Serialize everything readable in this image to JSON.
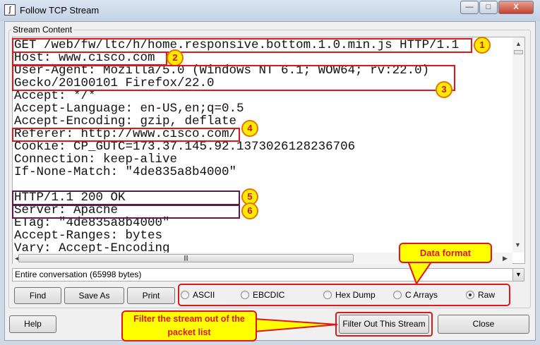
{
  "window": {
    "title": "Follow TCP Stream",
    "minimize": "—",
    "maximize": "□",
    "close": "X"
  },
  "group_label": "Stream Content",
  "stream_lines": [
    "GET /web/fw/ltc/h/home.responsive.bottom.1.0.min.js HTTP/1.1",
    "Host: www.cisco.com",
    "User-Agent: Mozilla/5.0 (Windows NT 6.1; WOW64; rv:22.0)",
    "Gecko/20100101 Firefox/22.0",
    "Accept: */*",
    "Accept-Language: en-US,en;q=0.5",
    "Accept-Encoding: gzip, deflate",
    "Referer: http://www.cisco.com/",
    "Cookie: CP_GUTC=173.37.145.92.1373026128236706",
    "Connection: keep-alive",
    "If-None-Match: \"4de835a8b4000\"",
    "",
    "HTTP/1.1 200 OK",
    "Server: Apache",
    "ETag: \"4de835a8b4000\"",
    "Accept-Ranges: bytes",
    "Vary: Accept-Encoding"
  ],
  "annotations": [
    "1",
    "2",
    "3",
    "4",
    "5",
    "6"
  ],
  "conversation_select": "Entire conversation (65998 bytes)",
  "buttons": {
    "find": "Find",
    "save_as": "Save As",
    "print": "Print",
    "help": "Help",
    "filter_out": "Filter Out This Stream",
    "close": "Close"
  },
  "formats": [
    {
      "label": "ASCII",
      "selected": false
    },
    {
      "label": "EBCDIC",
      "selected": false
    },
    {
      "label": "Hex Dump",
      "selected": false
    },
    {
      "label": "C Arrays",
      "selected": false
    },
    {
      "label": "Raw",
      "selected": true
    }
  ],
  "callouts": {
    "data_format": "Data format",
    "filter": "Filter the stream out of the packet list"
  },
  "colors": {
    "annotation": "#e0161a",
    "callout_bg": "#ffff00"
  }
}
